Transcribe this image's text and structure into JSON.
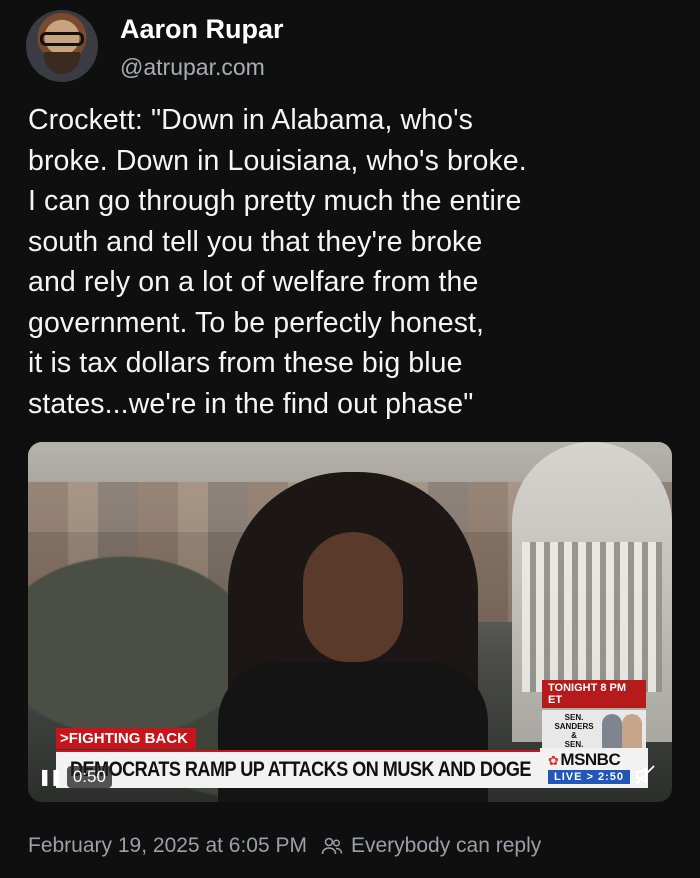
{
  "author": {
    "name": "Aaron Rupar",
    "handle": "@atrupar.com"
  },
  "post": {
    "text": "Crockett: \"Down in Alabama, who's\nbroke. Down in Louisiana, who's broke.\nI can go through pretty much the entire\nsouth and tell you that they're broke\nand rely on a lot of welfare from the\ngovernment. To be perfectly honest,\nit is tax dollars from these big blue\nstates...we're in the find out phase\""
  },
  "video": {
    "tonight_label": "TONIGHT 8 PM ET",
    "tonight_guests": "SEN. SANDERS\n&\nSEN. WARREN",
    "section_tag": ">FIGHTING BACK",
    "headline": "DEMOCRATS RAMP UP ATTACKS ON MUSK AND DOGE",
    "network": "MSNBC",
    "live_text": "LIVE > 2:50",
    "time": "0:50",
    "icons": [
      "pause-icon",
      "mute-icon"
    ]
  },
  "footer": {
    "timestamp": "February 19, 2025 at 6:05 PM",
    "reply_setting": "Everybody can reply"
  },
  "colors": {
    "background": "#0f0f10",
    "text": "#f5f5f5",
    "muted": "#9aa0a8",
    "news_red": "#c8141b",
    "live_blue": "#2057b8"
  }
}
